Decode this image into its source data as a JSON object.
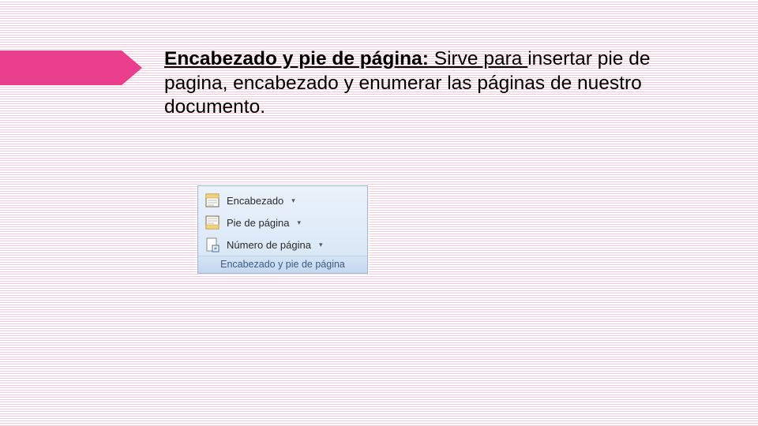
{
  "heading": {
    "title_bold": "Encabezado y pie de página:",
    "title_rest": " Sirve para",
    "body": "insertar pie de pagina, encabezado y enumerar las páginas de nuestro documento."
  },
  "ribbon": {
    "items": [
      {
        "icon": "header-icon",
        "label": "Encabezado"
      },
      {
        "icon": "footer-icon",
        "label": "Pie de página"
      },
      {
        "icon": "page-number-icon",
        "label": "Número de página"
      }
    ],
    "group_title": "Encabezado y pie de página"
  },
  "colors": {
    "accent": "#e83e8c",
    "ribbon_bg": "#eaf2fb"
  }
}
